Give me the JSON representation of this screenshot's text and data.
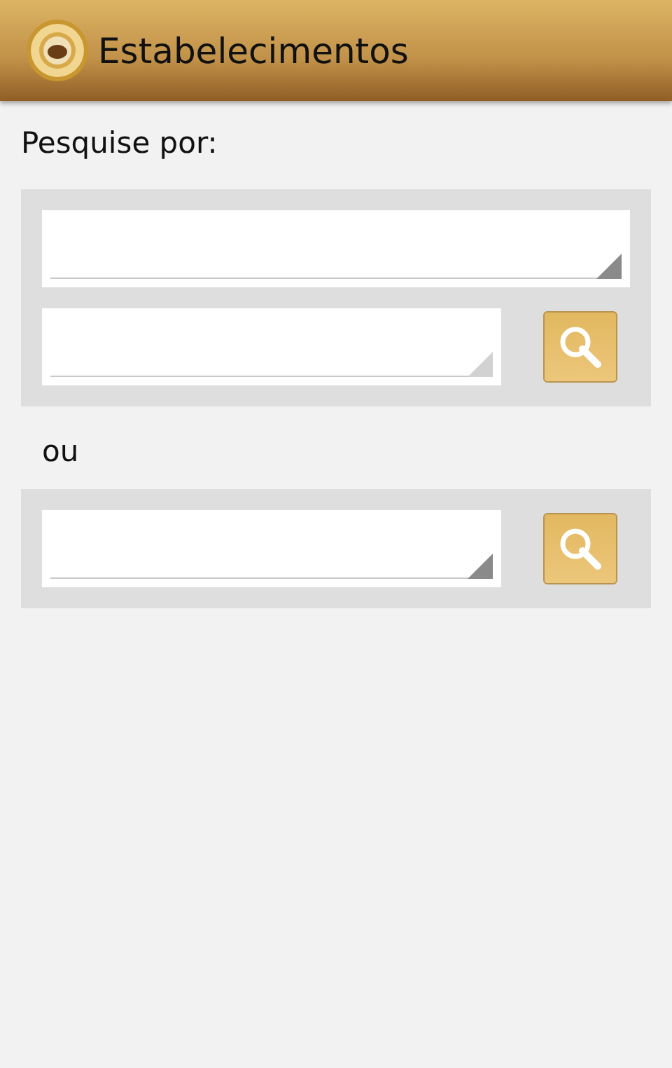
{
  "app_bar": {
    "title": "Estabelecimentos"
  },
  "prompt": "Pesquise por:",
  "groups": [
    {
      "rows": [
        {
          "kind": "select",
          "disabled": false
        },
        {
          "kind": "select_search",
          "disabled": true
        }
      ]
    },
    {
      "separator": "ou",
      "rows": [
        {
          "kind": "select_search",
          "disabled": false
        }
      ]
    }
  ]
}
